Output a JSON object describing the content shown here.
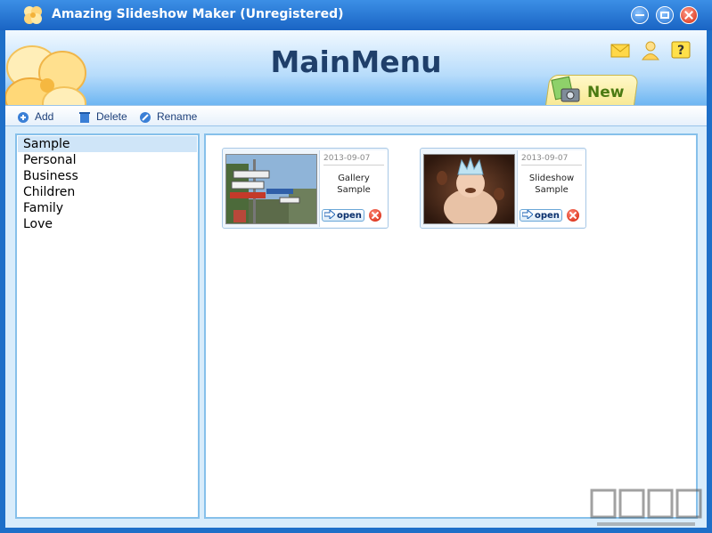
{
  "window": {
    "title": "Amazing Slideshow Maker (Unregistered)"
  },
  "header": {
    "title": "MainMenu",
    "new_label": "New"
  },
  "toolbar": {
    "add_label": "Add",
    "delete_label": "Delete",
    "rename_label": "Rename"
  },
  "sidebar": {
    "categories": [
      "Sample",
      "Personal",
      "Business",
      "Children",
      "Family",
      "Love"
    ],
    "selected": "Sample"
  },
  "projects": [
    {
      "date": "2013-09-07",
      "name": "Gallery\nSample",
      "open_label": "open",
      "thumbnail": "street-signs-photo"
    },
    {
      "date": "2013-09-07",
      "name": "Slideshow\nSample",
      "open_label": "open",
      "thumbnail": "baby-photo"
    }
  ],
  "colors": {
    "titlebar": "#1a64c4",
    "header_title": "#1f3f6a",
    "selection": "#cfe5f8",
    "border": "#86c0ea"
  }
}
